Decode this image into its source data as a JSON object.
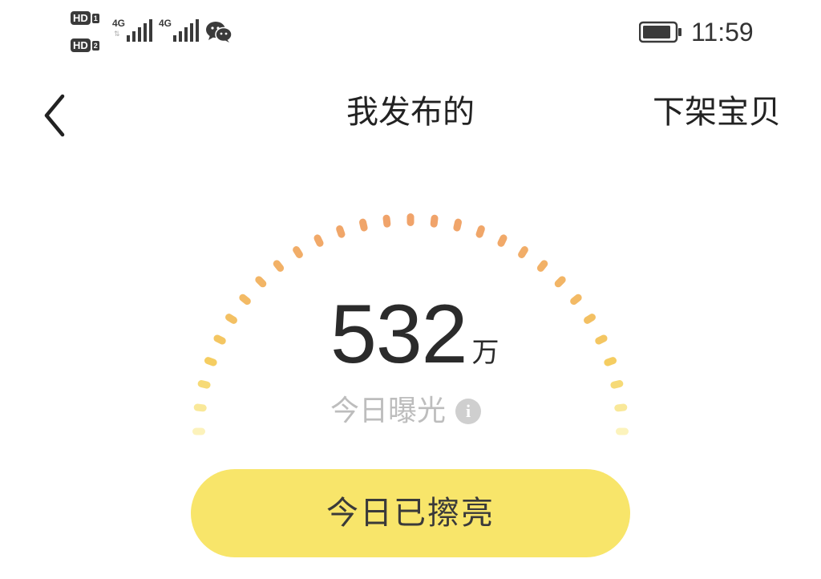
{
  "status_bar": {
    "hd_label": "HD",
    "sim_slots": [
      "1",
      "2"
    ],
    "network": [
      "4G",
      "4G"
    ],
    "time": "11:59",
    "icons": [
      "hd-icon",
      "signal-icon",
      "wechat-icon",
      "battery-icon"
    ]
  },
  "nav": {
    "title": "我发布的",
    "right_action": "下架宝贝",
    "back_icon": "back-chevron-icon"
  },
  "exposure": {
    "value": "532",
    "unit": "万",
    "label": "今日曝光",
    "info_icon": "info-icon",
    "info_glyph": "i"
  },
  "polish_button": {
    "label": "今日已擦亮"
  },
  "colors": {
    "gauge_top": "#f0a36a",
    "gauge_bottom": "#f7e15c",
    "button_bg": "#f8e56a",
    "label_gray": "#bdbdbd"
  }
}
